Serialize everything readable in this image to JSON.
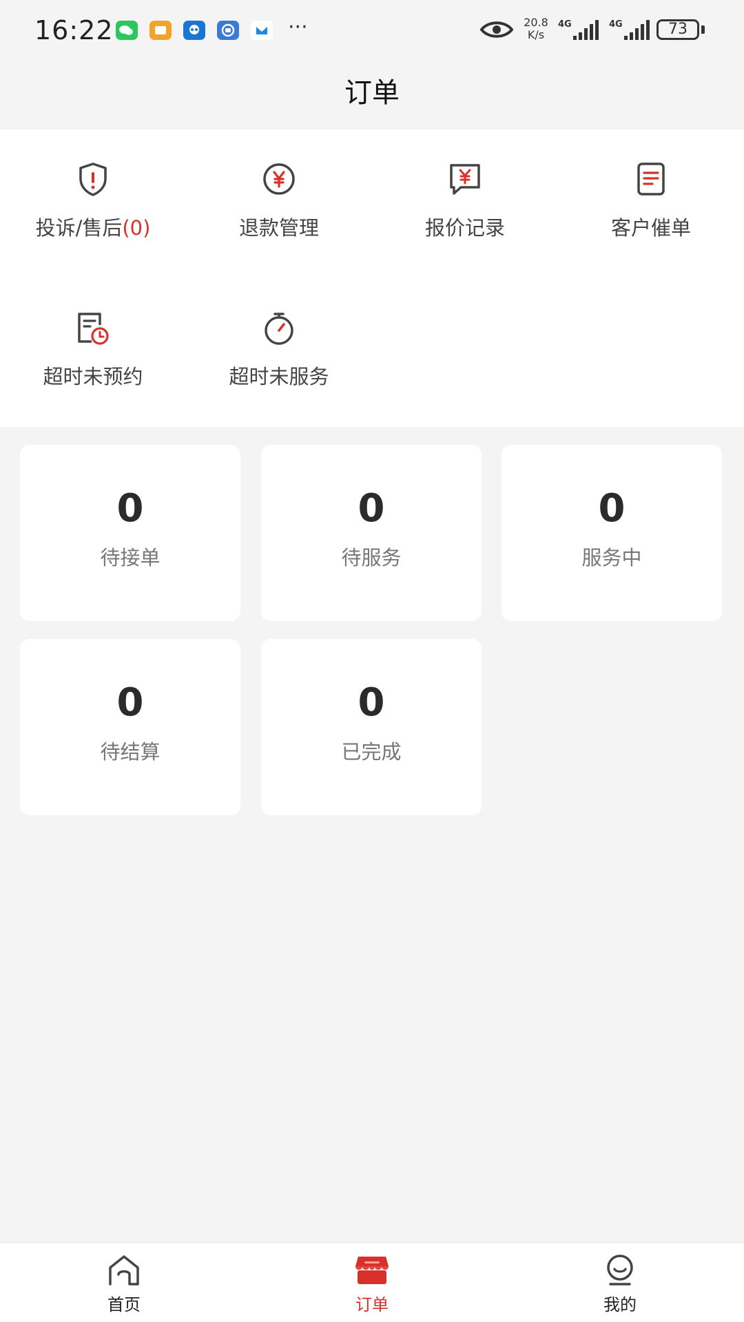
{
  "status_bar": {
    "time": "16:22",
    "app_icons": [
      {
        "name": "wechat-icon",
        "color": "#2dc55e"
      },
      {
        "name": "wallet-icon",
        "color": "#f2a42a"
      },
      {
        "name": "bot-icon",
        "color": "#1976d2"
      },
      {
        "name": "app-icon",
        "color": "#3a7bd5"
      },
      {
        "name": "mail-icon",
        "color": "#1e88e5"
      }
    ],
    "more": "···",
    "speed_value": "20.8",
    "speed_unit": "K/s",
    "network_1": "4G",
    "network_2": "4G",
    "battery": "73"
  },
  "header": {
    "title": "订单"
  },
  "quick_menu": {
    "items": [
      {
        "label": "投诉/售后",
        "count": "(0)",
        "icon": "shield-alert-icon"
      },
      {
        "label": "退款管理",
        "icon": "yuan-circle-icon"
      },
      {
        "label": "报价记录",
        "icon": "yuan-message-icon"
      },
      {
        "label": "客户催单",
        "icon": "document-icon"
      },
      {
        "label": "超时未预约",
        "icon": "document-clock-icon"
      },
      {
        "label": "超时未服务",
        "icon": "stopwatch-icon"
      }
    ]
  },
  "stats": [
    {
      "value": "0",
      "label": "待接单"
    },
    {
      "value": "0",
      "label": "待服务"
    },
    {
      "value": "0",
      "label": "服务中"
    },
    {
      "value": "0",
      "label": "待结算"
    },
    {
      "value": "0",
      "label": "已完成"
    }
  ],
  "tabbar": {
    "items": [
      {
        "label": "首页",
        "icon": "home-icon",
        "active": false
      },
      {
        "label": "订单",
        "icon": "store-icon",
        "active": true
      },
      {
        "label": "我的",
        "icon": "profile-icon",
        "active": false
      }
    ],
    "accent_color": "#d8312a"
  }
}
